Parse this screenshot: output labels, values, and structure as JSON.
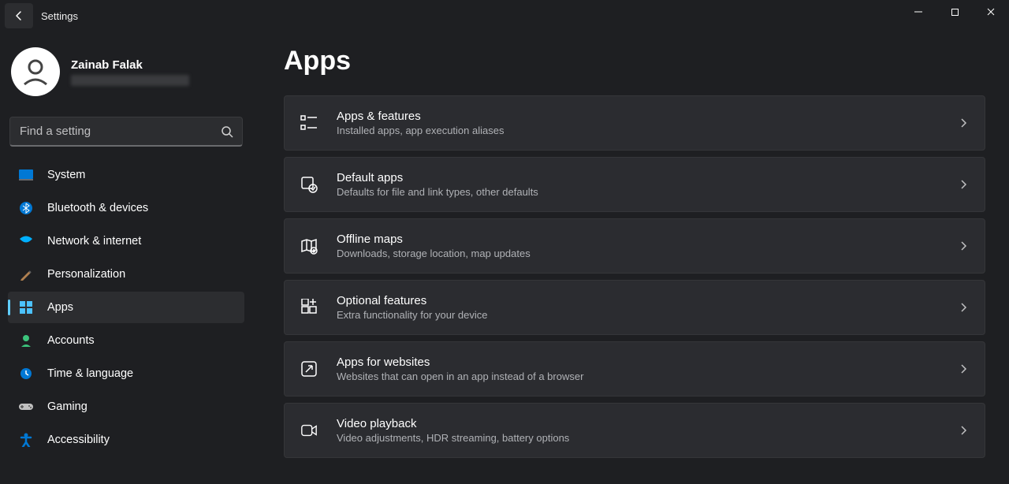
{
  "window": {
    "title": "Settings"
  },
  "user": {
    "name": "Zainab Falak"
  },
  "search": {
    "placeholder": "Find a setting"
  },
  "sidebar": {
    "items": [
      {
        "label": "System",
        "icon": "system",
        "active": false
      },
      {
        "label": "Bluetooth & devices",
        "icon": "bluetooth",
        "active": false
      },
      {
        "label": "Network & internet",
        "icon": "network",
        "active": false
      },
      {
        "label": "Personalization",
        "icon": "personalization",
        "active": false
      },
      {
        "label": "Apps",
        "icon": "apps",
        "active": true
      },
      {
        "label": "Accounts",
        "icon": "accounts",
        "active": false
      },
      {
        "label": "Time & language",
        "icon": "time",
        "active": false
      },
      {
        "label": "Gaming",
        "icon": "gaming",
        "active": false
      },
      {
        "label": "Accessibility",
        "icon": "accessibility",
        "active": false
      }
    ]
  },
  "page": {
    "title": "Apps"
  },
  "cards": [
    {
      "key": "apps-features",
      "title": "Apps & features",
      "desc": "Installed apps, app execution aliases"
    },
    {
      "key": "default-apps",
      "title": "Default apps",
      "desc": "Defaults for file and link types, other defaults"
    },
    {
      "key": "offline-maps",
      "title": "Offline maps",
      "desc": "Downloads, storage location, map updates"
    },
    {
      "key": "optional-features",
      "title": "Optional features",
      "desc": "Extra functionality for your device"
    },
    {
      "key": "apps-for-websites",
      "title": "Apps for websites",
      "desc": "Websites that can open in an app instead of a browser"
    },
    {
      "key": "video-playback",
      "title": "Video playback",
      "desc": "Video adjustments, HDR streaming, battery options"
    }
  ]
}
